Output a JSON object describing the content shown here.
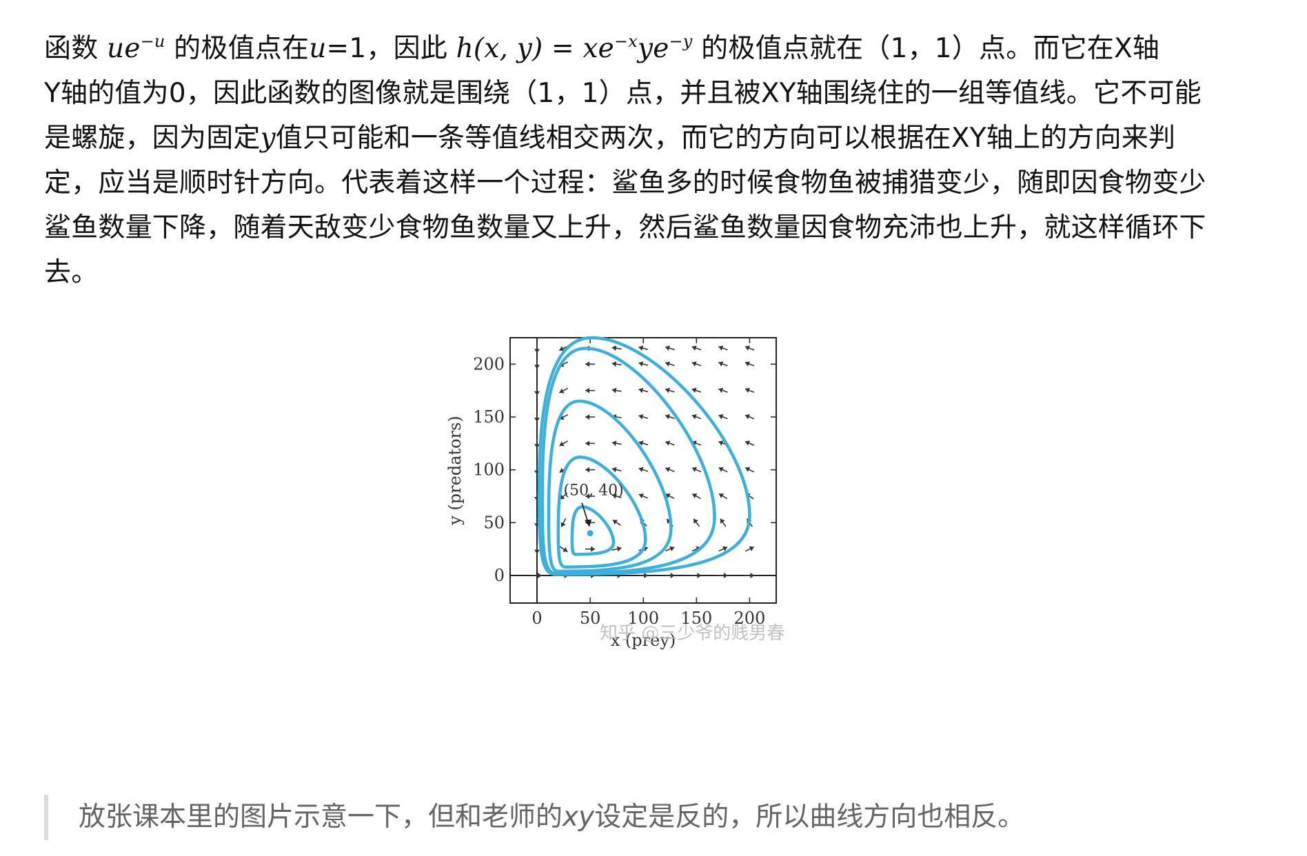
{
  "paragraph": {
    "lines": [
      [
        "函数 ",
        {
          "m": "ue",
          "sup": "−u"
        },
        " 的极值点在",
        {
          "i": "u"
        },
        "=1，因此 ",
        {
          "m": "h(x, y) = xe",
          "sup": "−x"
        },
        {
          "m": "ye",
          "sup": "−y"
        },
        " 的极值点就在（1，1）点。而它在X轴"
      ],
      [
        "Y轴的值为0，因此函数的图像就是围绕（1，1）点，并且被XY轴围绕住的一组等值线。它不可能"
      ],
      [
        "是螺旋，因为固定",
        {
          "i": "y"
        },
        "值只可能和一条等值线相交两次，而它的方向可以根据在XY轴上的方向来判"
      ],
      [
        "定，应当是顺时针方向。代表着这样一个过程：鲨鱼多的时候食物鱼被捕猎变少，随即因食物变少"
      ],
      [
        "鲨鱼数量下降，随着天敌变少食物鱼数量又上升，然后鲨鱼数量因食物充沛也上升，就这样循环下"
      ],
      [
        "去。"
      ]
    ]
  },
  "chart_data": {
    "type": "phase-portrait",
    "xlabel": "x (prey)",
    "ylabel": "y (predators)",
    "xlim": [
      -50,
      225
    ],
    "ylim": [
      -55,
      225
    ],
    "xticks": [
      0,
      50,
      100,
      150,
      200
    ],
    "yticks": [
      0,
      50,
      100,
      150,
      200
    ],
    "equilibrium": {
      "x": 50,
      "y": 40,
      "label": "(50, 40)"
    },
    "orbits": [
      {
        "xmin": 33,
        "xmax": 72,
        "ymin": 20,
        "ymax": 65
      },
      {
        "xmin": 20,
        "xmax": 102,
        "ymin": 8,
        "ymax": 112
      },
      {
        "xmin": 11,
        "xmax": 126,
        "ymin": 4,
        "ymax": 165
      },
      {
        "xmin": 5,
        "xmax": 167,
        "ymin": 2,
        "ymax": 215
      },
      {
        "xmin": 2,
        "xmax": 200,
        "ymin": 1,
        "ymax": 225
      }
    ],
    "curve_color": "#3ab0de",
    "watermark": "知乎 @三少爷的贱男春"
  },
  "quote": {
    "pre": "放张课本里的图片示意一下，但和老师的",
    "it": "xy",
    "post": "设定是反的，所以曲线方向也相反。"
  }
}
